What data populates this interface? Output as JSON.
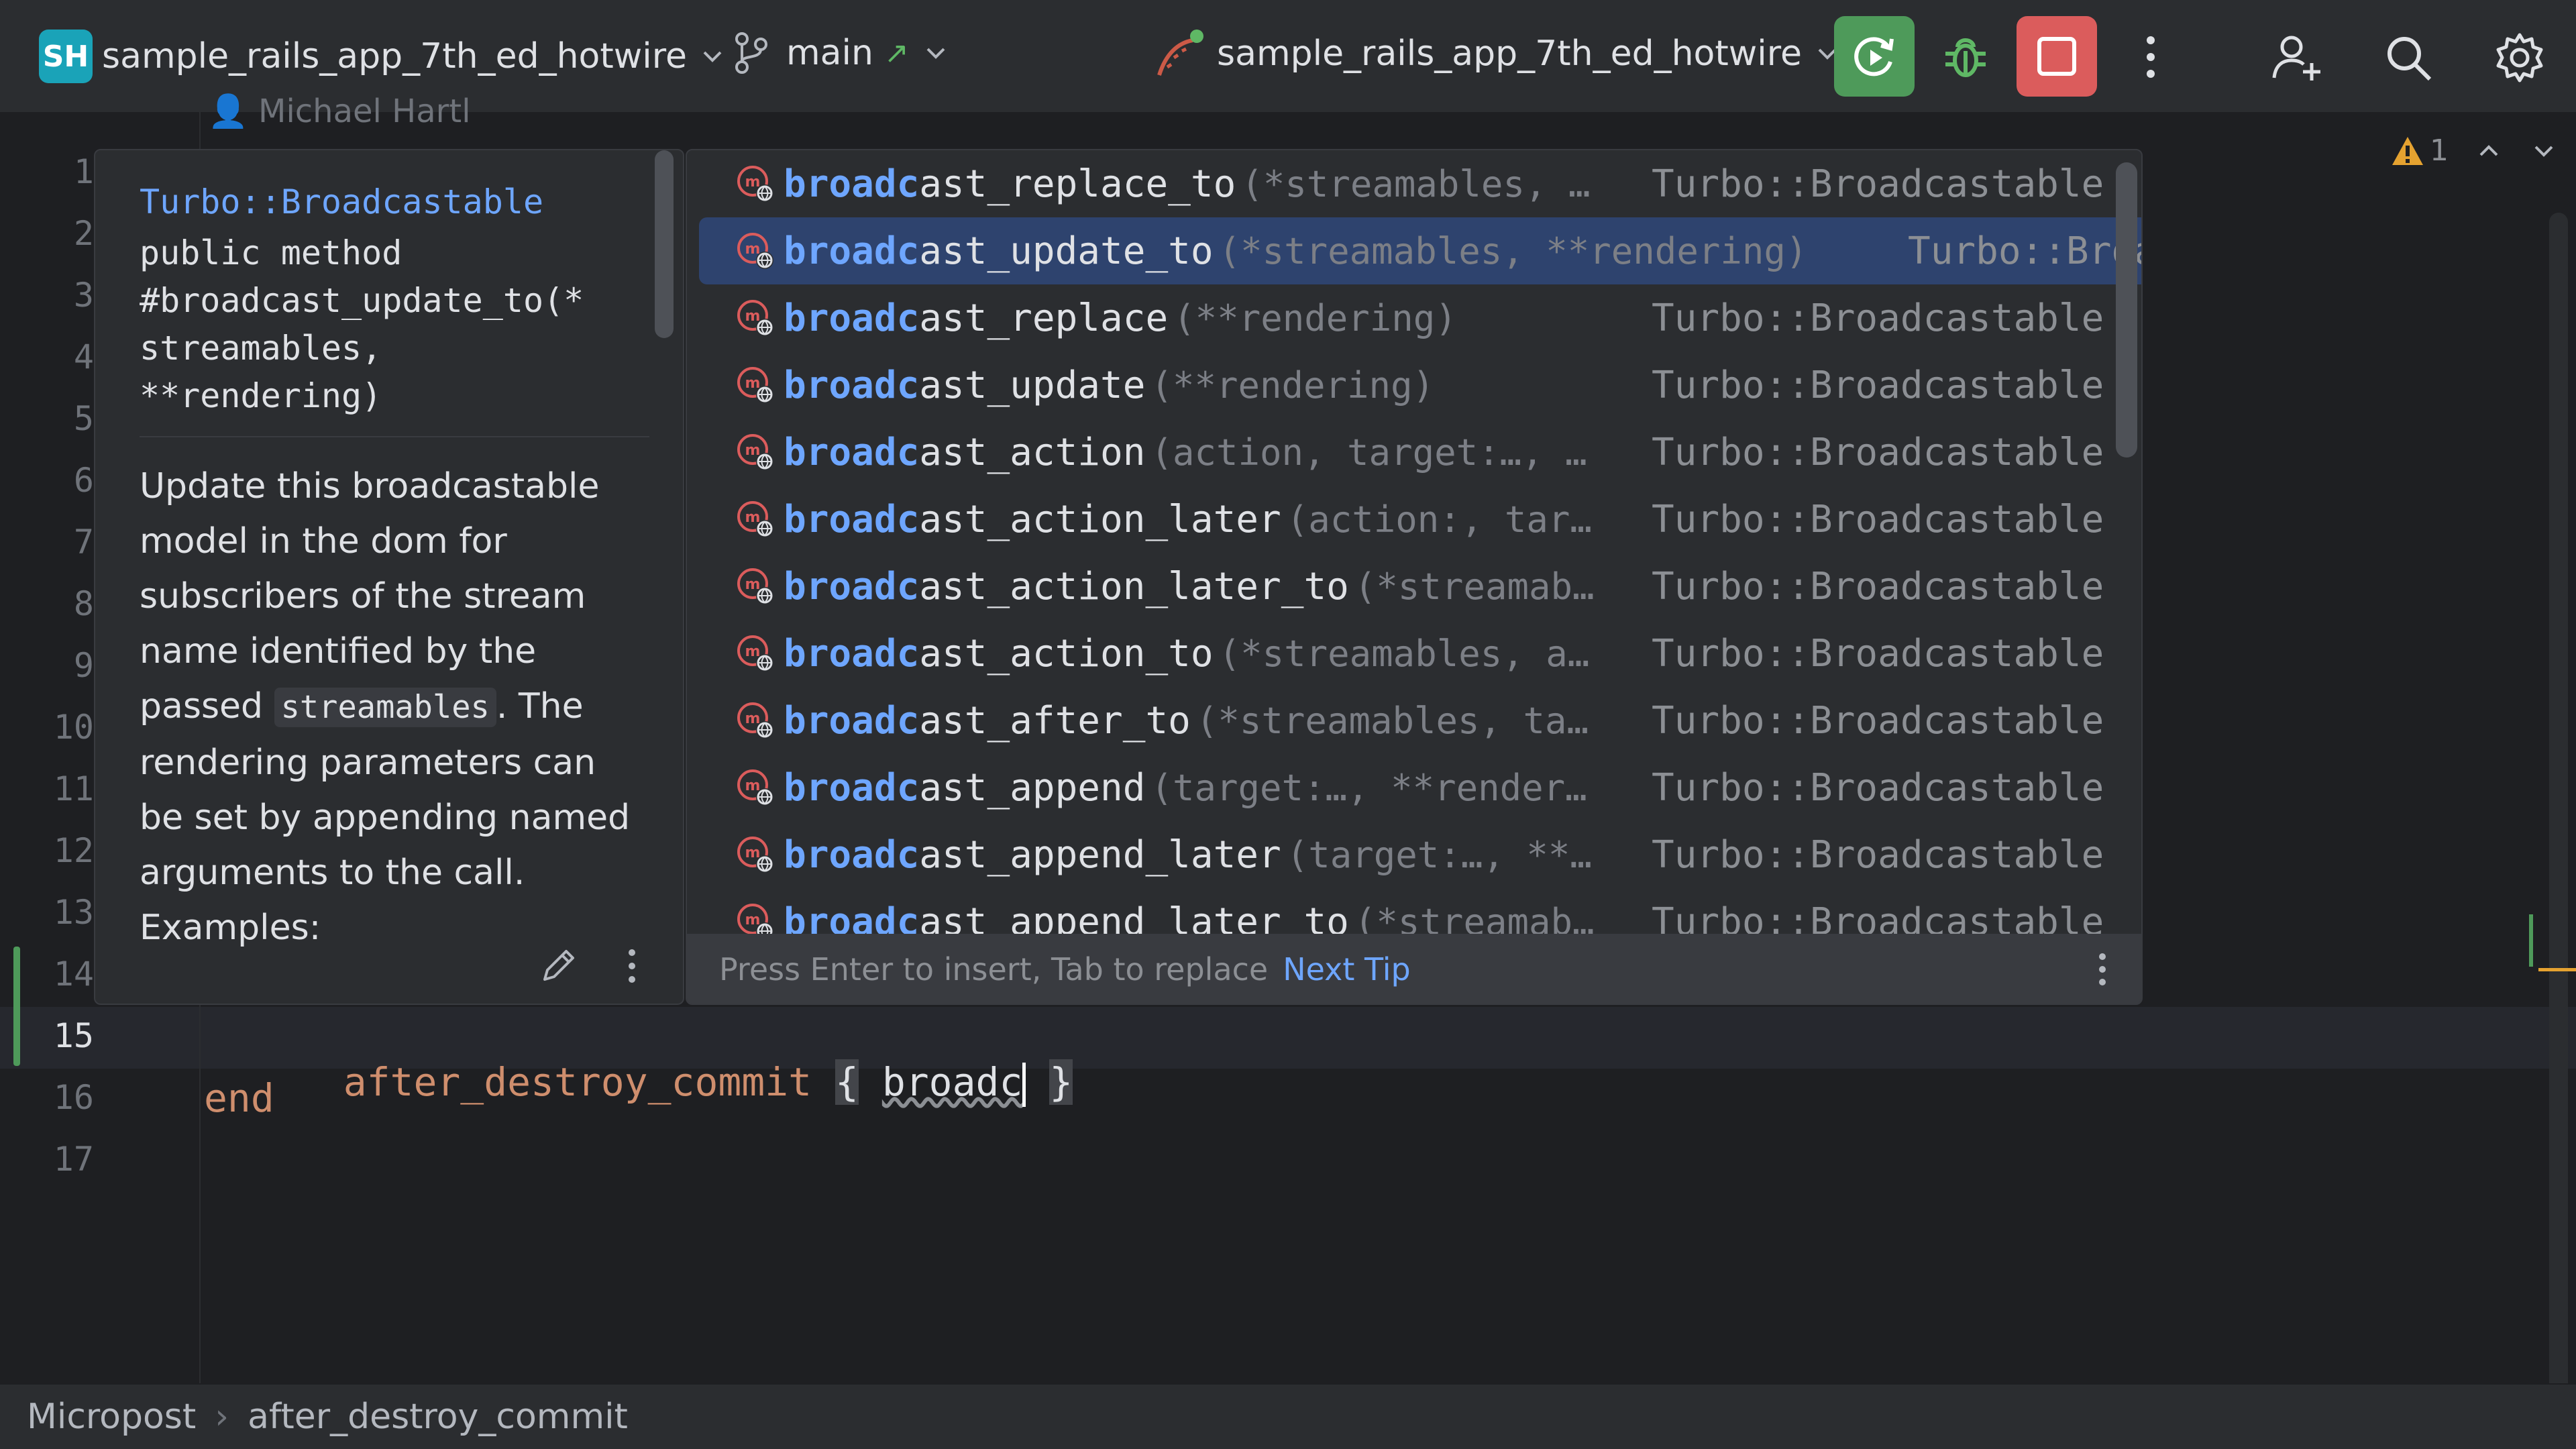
{
  "toolbar": {
    "project_badge": "SH",
    "project_name": "sample_rails_app_7th_ed_hotwire",
    "branch": "main",
    "branch_arrow": "↗",
    "run_config": "sample_rails_app_7th_ed_hotwire"
  },
  "editor": {
    "author_hint": "Michael Hartl",
    "line_numbers": [
      "1",
      "2",
      "3",
      "4",
      "5",
      "6",
      "7",
      "8",
      "9",
      "10",
      "11",
      "12",
      "13",
      "14",
      "15",
      "16",
      "17"
    ],
    "current_line": "15",
    "warnings_count": "1",
    "line15": {
      "callback": "after_destroy_commit",
      "open_brace": "{",
      "typed": "broadc",
      "close_brace": "}"
    },
    "line16": "end"
  },
  "doc_popup": {
    "qualifier": "Turbo::Broadcastable",
    "signature": "public method\n#broadcast_update_to(*\nstreamables,\n**rendering)",
    "body_before": "Update this broadcastable model in the dom for subscribers of the stream name identified by the passed ",
    "body_code": "streamables",
    "body_after": ". The rendering parameters can be set by appending named arguments to the call. Examples:"
  },
  "completion": {
    "match_prefix": "broadc",
    "items": [
      {
        "rest": "ast_replace_to",
        "params": "(*streamables, …",
        "owner": "Turbo::Broadcastable"
      },
      {
        "rest": "ast_update_to",
        "params": "(*streamables, **rendering)",
        "owner": "Turbo::Broadcastable"
      },
      {
        "rest": "ast_replace",
        "params": "(**rendering)",
        "owner": "Turbo::Broadcastable"
      },
      {
        "rest": "ast_update",
        "params": "(**rendering)",
        "owner": "Turbo::Broadcastable"
      },
      {
        "rest": "ast_action",
        "params": "(action, target:…, …",
        "owner": "Turbo::Broadcastable"
      },
      {
        "rest": "ast_action_later",
        "params": "(action:, tar…",
        "owner": "Turbo::Broadcastable"
      },
      {
        "rest": "ast_action_later_to",
        "params": "(*streamab…",
        "owner": "Turbo::Broadcastable"
      },
      {
        "rest": "ast_action_to",
        "params": "(*streamables, a…",
        "owner": "Turbo::Broadcastable"
      },
      {
        "rest": "ast_after_to",
        "params": "(*streamables, ta…",
        "owner": "Turbo::Broadcastable"
      },
      {
        "rest": "ast_append",
        "params": "(target:…, **render…",
        "owner": "Turbo::Broadcastable"
      },
      {
        "rest": "ast_append_later",
        "params": "(target:…, **…",
        "owner": "Turbo::Broadcastable"
      },
      {
        "rest": "ast_append_later_to",
        "params": "(*streamab…",
        "owner": "Turbo::Broadcastable"
      }
    ],
    "selected_index": 1,
    "footer_hint": "Press Enter to insert, Tab to replace",
    "footer_tip": "Next Tip"
  },
  "breadcrumbs": [
    "Micropost",
    "after_destroy_commit"
  ],
  "breadcrumb_separator": "›",
  "colors": {
    "accent": "#6ea6ff",
    "selection": "#2e436e",
    "run_button": "#4e9a5a",
    "stop_button": "#db5c5c",
    "keyword": "#cf8e6d",
    "warning": "#e5a230"
  }
}
